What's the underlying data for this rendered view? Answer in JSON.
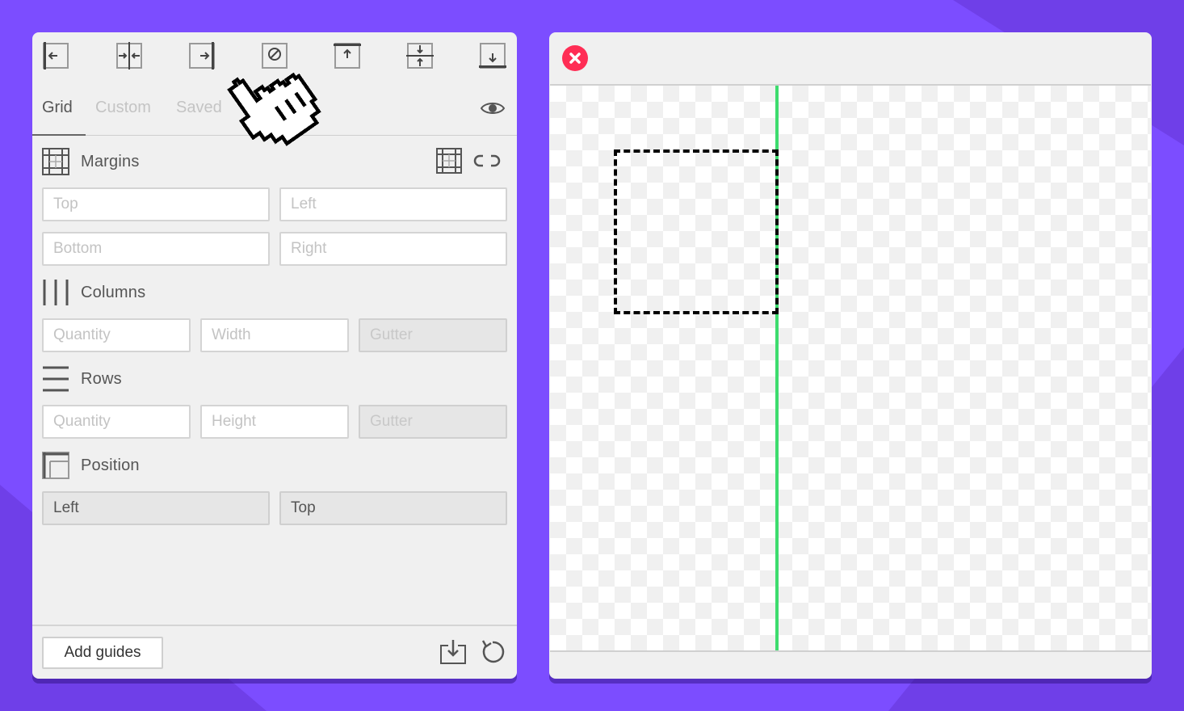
{
  "panel": {
    "toolbar_icons": [
      "align-left-icon",
      "align-center-horizontal-icon",
      "align-right-icon",
      "clear-guides-icon",
      "align-top-icon",
      "align-center-vertical-icon",
      "align-bottom-icon"
    ],
    "tabs": [
      {
        "label": "Grid",
        "active": true
      },
      {
        "label": "Custom",
        "active": false
      },
      {
        "label": "Saved",
        "active": false
      }
    ],
    "margins": {
      "title": "Margins",
      "top_placeholder": "Top",
      "left_placeholder": "Left",
      "bottom_placeholder": "Bottom",
      "right_placeholder": "Right"
    },
    "columns": {
      "title": "Columns",
      "quantity_placeholder": "Quantity",
      "width_placeholder": "Width",
      "gutter_placeholder": "Gutter"
    },
    "rows": {
      "title": "Rows",
      "quantity_placeholder": "Quantity",
      "height_placeholder": "Height",
      "gutter_placeholder": "Gutter"
    },
    "position": {
      "title": "Position",
      "left_value": "Left",
      "top_value": "Top"
    },
    "footer": {
      "add_guides_label": "Add guides"
    }
  },
  "colors": {
    "background": "#7c4dff",
    "guide": "#3ddc6e",
    "close_button": "#ff2d55"
  }
}
